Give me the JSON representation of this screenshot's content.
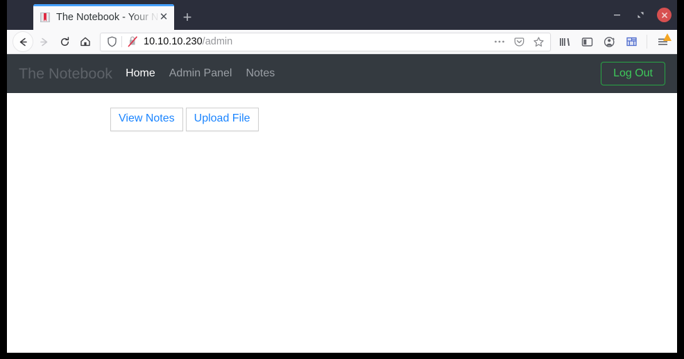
{
  "browser": {
    "tab": {
      "title": "The Notebook - Your Not",
      "favicon": "notebook-icon",
      "close_label": "✕"
    },
    "new_tab_label": "+",
    "window_controls": {
      "minimize": "–",
      "restore": "❐",
      "close": "✕"
    },
    "toolbar": {
      "back": "back-arrow-icon",
      "forward": "forward-arrow-icon",
      "reload": "reload-icon",
      "home": "home-icon"
    },
    "urlbar": {
      "shield_icon": "tracking-protection-shield-icon",
      "connection_icon": "insecure-connection-icon",
      "url_host": "10.10.10.230",
      "url_path": "/admin",
      "page_actions_icon": "ellipsis-icon",
      "pocket_icon": "pocket-icon",
      "bookmark_icon": "star-icon"
    },
    "toolbar_right": {
      "library_icon": "library-icon",
      "sidebar_icon": "sidebar-icon",
      "account_icon": "account-warning-icon",
      "containers_icon": "container-tabs-grid-icon",
      "menu_icon": "hamburger-menu-icon",
      "menu_badge": "warning-triangle-badge"
    }
  },
  "site": {
    "brand": "The Notebook",
    "nav_links": [
      {
        "label": "Home",
        "active": true
      },
      {
        "label": "Admin Panel",
        "active": false
      },
      {
        "label": "Notes",
        "active": false
      }
    ],
    "logout_label": "Log Out",
    "buttons": [
      {
        "label": "View Notes"
      },
      {
        "label": "Upload File"
      }
    ]
  },
  "colors": {
    "navbar_bg": "#343a40",
    "logout_green": "#28a745",
    "link_blue": "#1a84ff",
    "tab_accent": "#45a1ff",
    "warning_orange": "#f5a623",
    "close_red": "#d75050"
  }
}
